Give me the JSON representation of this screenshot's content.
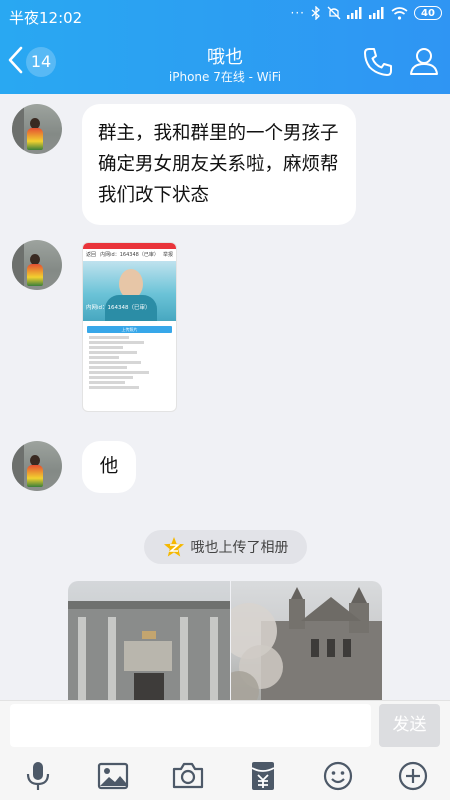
{
  "status_bar": {
    "time": "半夜12:02",
    "notifications": "···",
    "battery": "40"
  },
  "header": {
    "unread_count": "14",
    "contact_name": "哦也",
    "contact_status": "iPhone 7在线 - WiFi"
  },
  "messages": {
    "text1": "群主，我和群里的一个男孩子确定男女朋友关系啦，麻烦帮我们改下状态",
    "screenshot": {
      "nav_back": "返回",
      "nav_title": "内网id：164348（已审）",
      "nav_right": "举报",
      "caption": "内网id：164348（已审）",
      "upload_button": "上传照片"
    },
    "text2": "他",
    "system_notice": "哦也上传了相册"
  },
  "input": {
    "placeholder": "",
    "send_label": "发送"
  },
  "colors": {
    "header_blue": "#2f9bf3",
    "chat_background": "#f0f1f5"
  }
}
